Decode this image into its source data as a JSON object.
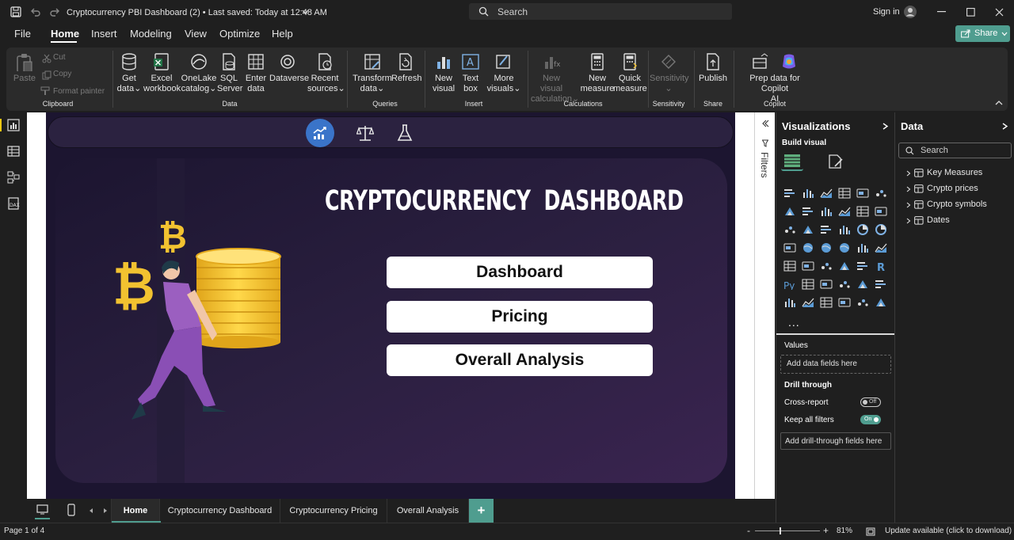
{
  "titlebar": {
    "doc_title": "Cryptocurrency PBI Dashboard (2) • Last saved: Today at 12:48 AM",
    "search_placeholder": "Search",
    "sign_in": "Sign in"
  },
  "menu": {
    "items": [
      "File",
      "Home",
      "Insert",
      "Modeling",
      "View",
      "Optimize",
      "Help"
    ],
    "active": "Home",
    "share_label": "Share"
  },
  "ribbon": {
    "clipboard": {
      "paste": "Paste",
      "cut": "Cut",
      "copy": "Copy",
      "format_painter": "Format painter",
      "group": "Clipboard"
    },
    "data": {
      "get_data": [
        "Get",
        "data"
      ],
      "excel": [
        "Excel",
        "workbook"
      ],
      "onelake": [
        "OneLake",
        "catalog"
      ],
      "sql": [
        "SQL",
        "Server"
      ],
      "enter": [
        "Enter",
        "data"
      ],
      "dataverse": [
        "Dataverse"
      ],
      "recent": [
        "Recent",
        "sources"
      ],
      "group": "Data"
    },
    "queries": {
      "transform": [
        "Transform",
        "data"
      ],
      "refresh": [
        "Refresh"
      ],
      "group": "Queries"
    },
    "insert": {
      "new_visual": [
        "New",
        "visual"
      ],
      "text_box": [
        "Text",
        "box"
      ],
      "more_visuals": [
        "More",
        "visuals"
      ],
      "group": "Insert"
    },
    "calculations": {
      "new_visual_calc": [
        "New visual",
        "calculation"
      ],
      "new_measure": [
        "New",
        "measure"
      ],
      "quick_measure": [
        "Quick",
        "measure"
      ],
      "group": "Calculations"
    },
    "sensitivity": {
      "label": [
        "Sensitivity"
      ],
      "group": "Sensitivity"
    },
    "share": {
      "publish": [
        "Publish"
      ],
      "group": "Share"
    },
    "copilot": {
      "prep": [
        "Prep data for Copilot",
        "AI"
      ],
      "group": "Copilot"
    }
  },
  "report": {
    "title": "CRYPTOCURRENCY  DASHBOARD",
    "buttons": [
      "Dashboard",
      "Pricing",
      "Overall Analysis"
    ],
    "bitcoin_symbol": "₿"
  },
  "filters": {
    "label": "Filters"
  },
  "visualizations": {
    "title": "Visualizations",
    "build_visual": "Build visual",
    "values_label": "Values",
    "values_placeholder": "Add data fields here",
    "drill_through": "Drill through",
    "cross_report": "Cross-report",
    "cross_report_state": "Off",
    "keep_filters": "Keep all filters",
    "keep_filters_state": "On",
    "drill_placeholder": "Add drill-through fields here",
    "more": "...",
    "r_label": "R",
    "py_label": "Py"
  },
  "data_pane": {
    "title": "Data",
    "search_placeholder": "Search",
    "tables": [
      "Key Measures",
      "Crypto prices",
      "Crypto symbols",
      "Dates"
    ]
  },
  "tabs": {
    "pages": [
      "Home",
      "Cryptocurrency Dashboard",
      "Cryptocurrency Pricing",
      "Overall Analysis"
    ],
    "active": "Home",
    "add": "+"
  },
  "status": {
    "page": "Page 1 of 4",
    "zoom_minus": "-",
    "zoom_plus": "+",
    "zoom": "81%",
    "update": "Update available (click to download)"
  },
  "colors": {
    "accent": "#4f9d8f",
    "report_bg": "#231a33",
    "nav_bg": "#2b2240",
    "active_nav_icon": "#3a74c9",
    "coin": "#f2c230",
    "person_shirt": "#9b5fc0"
  }
}
